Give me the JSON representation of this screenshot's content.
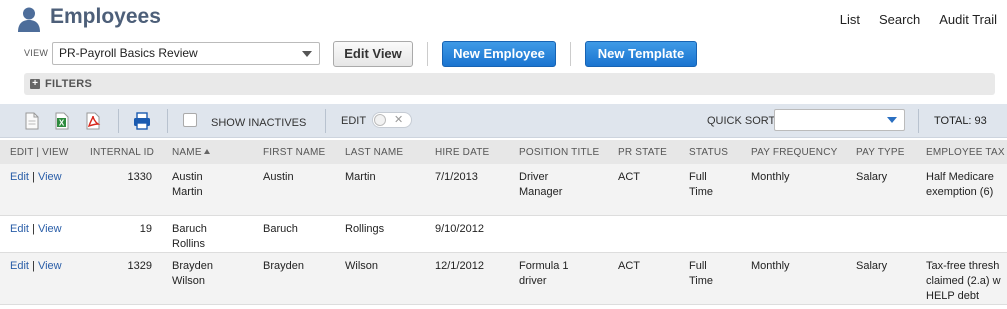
{
  "header": {
    "title": "Employees",
    "nav": [
      "List",
      "Search",
      "Audit Trail"
    ]
  },
  "controls": {
    "view_label": "VIEW",
    "view_selected": "PR-Payroll Basics Review",
    "edit_view_label": "Edit View",
    "new_employee_label": "New Employee",
    "new_template_label": "New Template"
  },
  "filters": {
    "label": "FILTERS"
  },
  "toolbar": {
    "show_inactives": "SHOW INACTIVES",
    "edit_label": "EDIT",
    "quick_sort_label": "QUICK SORT",
    "quick_sort_value": "",
    "total": "TOTAL: 93",
    "icons": [
      "document-icon",
      "excel-icon",
      "pdf-icon",
      "print-icon"
    ]
  },
  "table": {
    "columns": [
      "EDIT | VIEW",
      "INTERNAL ID",
      "NAME",
      "FIRST NAME",
      "LAST NAME",
      "HIRE DATE",
      "POSITION TITLE",
      "PR STATE",
      "STATUS",
      "PAY FREQUENCY",
      "PAY TYPE",
      "EMPLOYEE TAX S"
    ],
    "edit_label": "Edit",
    "view_label": "View",
    "rows": [
      {
        "internal_id": "1330",
        "name_line1": "Austin",
        "name_line2": "Martin",
        "first_name": "Austin",
        "last_name": "Martin",
        "hire_date": "7/1/2013",
        "position_line1": "Driver",
        "position_line2": "Manager",
        "pr_state": "ACT",
        "status_line1": "Full",
        "status_line2": "Time",
        "pay_frequency": "Monthly",
        "pay_type": "Salary",
        "tax_line1": "Half Medicare",
        "tax_line2": "exemption (6)",
        "tax_line3": ""
      },
      {
        "internal_id": "19",
        "name_line1": "Baruch",
        "name_line2": "Rollins",
        "first_name": "Baruch",
        "last_name": "Rollings",
        "hire_date": "9/10/2012",
        "position_line1": "",
        "position_line2": "",
        "pr_state": "",
        "status_line1": "",
        "status_line2": "",
        "pay_frequency": "",
        "pay_type": "",
        "tax_line1": "",
        "tax_line2": "",
        "tax_line3": ""
      },
      {
        "internal_id": "1329",
        "name_line1": "Brayden",
        "name_line2": "Wilson",
        "first_name": "Brayden",
        "last_name": "Wilson",
        "hire_date": "12/1/2012",
        "position_line1": "Formula 1",
        "position_line2": "driver",
        "pr_state": "ACT",
        "status_line1": "Full",
        "status_line2": "Time",
        "pay_frequency": "Monthly",
        "pay_type": "Salary",
        "tax_line1": "Tax-free thresh",
        "tax_line2": "claimed (2.a) w",
        "tax_line3": "HELP debt"
      }
    ]
  },
  "colors": {
    "title": "#4d5f79",
    "primary_button": "#1a74d0",
    "toolbar_bg": "#dfe5ed",
    "link": "#2a5ea8"
  }
}
